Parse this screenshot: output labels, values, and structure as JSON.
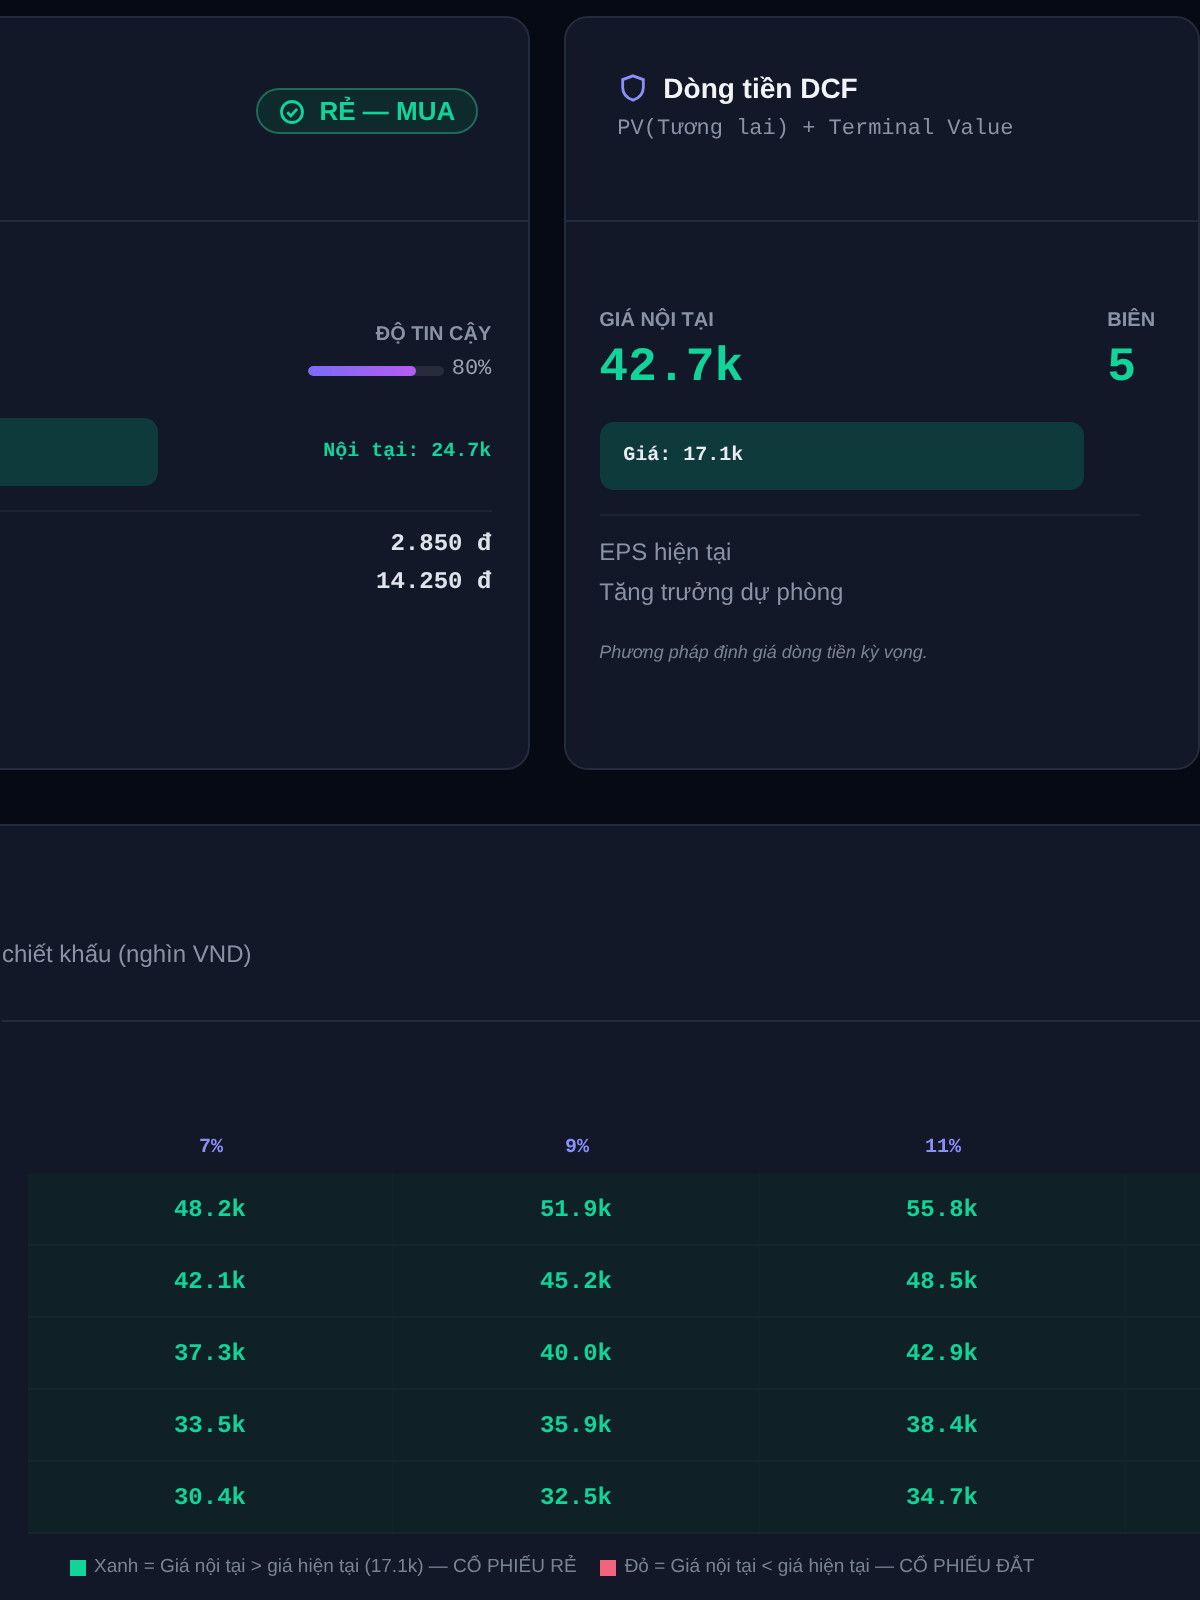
{
  "valuation_card": {
    "badge": "RẺ — MUA",
    "confidence": {
      "label": "ĐỘ TIN CẬY",
      "level": 0.8,
      "reading": "80%"
    },
    "intrinsic_note": "Nội tại: 24.7k",
    "values": [
      "2.850 đ",
      "14.250 đ"
    ]
  },
  "dcf_card": {
    "title": "Dòng tiền DCF",
    "subtitle": "PV(Tương lai) + Terminal Value",
    "stats": [
      {
        "label": "GIÁ NỘI TẠI",
        "value": "42.7k"
      },
      {
        "label": "BIÊN",
        "value": "5"
      }
    ],
    "price_note": "Giá: 17.1k",
    "rows": [
      "EPS hiện tại",
      "Tăng trưởng dự phòng"
    ],
    "footnote": "Phương pháp định giá dòng tiền kỳ vọng."
  },
  "sensitivity": {
    "subtitle": "chiết khấu (nghìn VND)",
    "columns": [
      "7%",
      "9%",
      "11%"
    ],
    "rows": [
      {
        "cells": [
          {
            "value": "48.2k",
            "cheap": true
          },
          {
            "value": "51.9k",
            "cheap": true
          },
          {
            "value": "55.8k",
            "cheap": true
          }
        ]
      },
      {
        "cells": [
          {
            "value": "42.1k",
            "cheap": true
          },
          {
            "value": "45.2k",
            "cheap": true
          },
          {
            "value": "48.5k",
            "cheap": true
          }
        ]
      },
      {
        "cells": [
          {
            "value": "37.3k",
            "cheap": true
          },
          {
            "value": "40.0k",
            "cheap": true
          },
          {
            "value": "42.9k",
            "cheap": true
          }
        ]
      },
      {
        "cells": [
          {
            "value": "33.5k",
            "cheap": true
          },
          {
            "value": "35.9k",
            "cheap": true
          },
          {
            "value": "38.4k",
            "cheap": true
          }
        ]
      },
      {
        "cells": [
          {
            "value": "30.4k",
            "cheap": true
          },
          {
            "value": "32.5k",
            "cheap": true
          },
          {
            "value": "34.7k",
            "cheap": true
          }
        ]
      }
    ],
    "legend": [
      {
        "color": "#10d49a",
        "text": "Xanh = Giá nội tại > giá hiện tại (17.1k) — CỔ PHIẾU RẺ"
      },
      {
        "color": "#f0647e",
        "text": "Đỏ = Giá nội tại < giá hiện tại — CỔ PHIẾU ĐẮT"
      }
    ]
  }
}
